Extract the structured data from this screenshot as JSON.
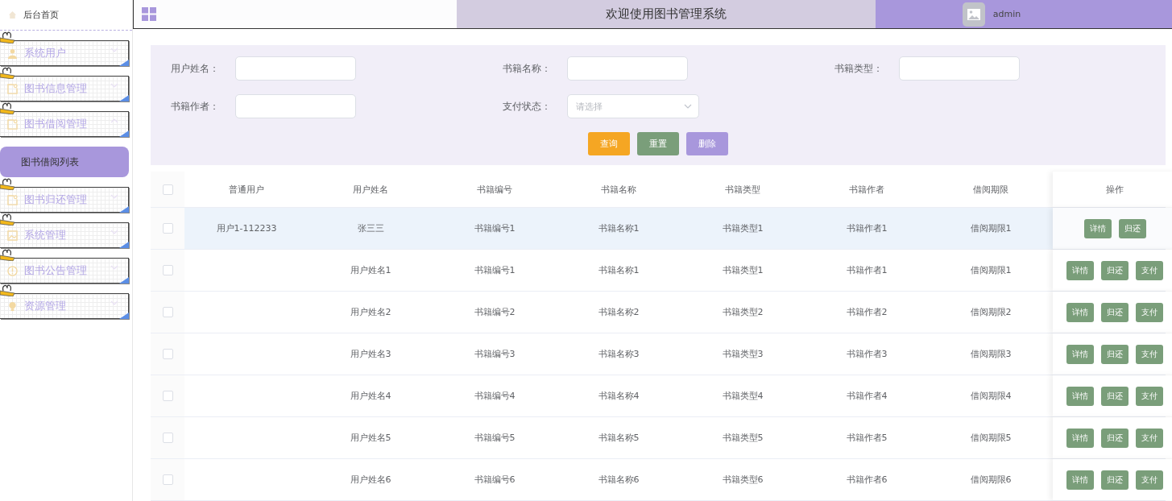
{
  "sidebar": {
    "home": "后台首页",
    "menus": [
      {
        "label": "系统用户",
        "expanded": false
      },
      {
        "label": "图书信息管理",
        "expanded": false
      },
      {
        "label": "图书借阅管理",
        "expanded": true,
        "children": [
          {
            "label": "图书借阅列表",
            "selected": true
          }
        ]
      },
      {
        "label": "图书归还管理",
        "expanded": false
      },
      {
        "label": "系统管理",
        "expanded": false
      },
      {
        "label": "图书公告管理",
        "expanded": false
      },
      {
        "label": "资源管理",
        "expanded": false
      }
    ]
  },
  "header": {
    "title": "欢迎使用图书管理系统",
    "user": "admin"
  },
  "search": {
    "fields": [
      {
        "label": "用户姓名：",
        "kind": "input"
      },
      {
        "label": "书籍名称：",
        "kind": "input"
      },
      {
        "label": "书籍类型：",
        "kind": "input"
      },
      {
        "label": "书籍作者：",
        "kind": "input"
      },
      {
        "label": "支付状态：",
        "kind": "select",
        "placeholder": "请选择"
      }
    ],
    "buttons": [
      {
        "label": "查询",
        "kind": "query"
      },
      {
        "label": "重置",
        "kind": "reset"
      },
      {
        "label": "删除",
        "kind": "delete"
      }
    ]
  },
  "table": {
    "all_checked": false,
    "columns": [
      "普通用户",
      "用户姓名",
      "书籍编号",
      "书籍名称",
      "书籍类型",
      "书籍作者",
      "借阅期限",
      "操作"
    ],
    "rows": [
      {
        "checked": false,
        "hovered": true,
        "cells": [
          "用户1-112233",
          "张三三",
          "书籍编号1",
          "书籍名称1",
          "书籍类型1",
          "书籍作者1",
          "借阅期限1"
        ],
        "actions": [
          "详情",
          "归还"
        ]
      },
      {
        "checked": false,
        "hovered": false,
        "cells": [
          "",
          "用户姓名1",
          "书籍编号1",
          "书籍名称1",
          "书籍类型1",
          "书籍作者1",
          "借阅期限1"
        ],
        "actions": [
          "详情",
          "归还",
          "支付"
        ]
      },
      {
        "checked": false,
        "hovered": false,
        "cells": [
          "",
          "用户姓名2",
          "书籍编号2",
          "书籍名称2",
          "书籍类型2",
          "书籍作者2",
          "借阅期限2"
        ],
        "actions": [
          "详情",
          "归还",
          "支付"
        ]
      },
      {
        "checked": false,
        "hovered": false,
        "cells": [
          "",
          "用户姓名3",
          "书籍编号3",
          "书籍名称3",
          "书籍类型3",
          "书籍作者3",
          "借阅期限3"
        ],
        "actions": [
          "详情",
          "归还",
          "支付"
        ]
      },
      {
        "checked": false,
        "hovered": false,
        "cells": [
          "",
          "用户姓名4",
          "书籍编号4",
          "书籍名称4",
          "书籍类型4",
          "书籍作者4",
          "借阅期限4"
        ],
        "actions": [
          "详情",
          "归还",
          "支付"
        ]
      },
      {
        "checked": false,
        "hovered": false,
        "cells": [
          "",
          "用户姓名5",
          "书籍编号5",
          "书籍名称5",
          "书籍类型5",
          "书籍作者5",
          "借阅期限5"
        ],
        "actions": [
          "详情",
          "归还",
          "支付"
        ]
      },
      {
        "checked": false,
        "hovered": false,
        "cells": [
          "",
          "用户姓名6",
          "书籍编号6",
          "书籍名称6",
          "书籍类型6",
          "书籍作者6",
          "借阅期限6"
        ],
        "actions": [
          "详情",
          "归还",
          "支付"
        ]
      }
    ]
  }
}
